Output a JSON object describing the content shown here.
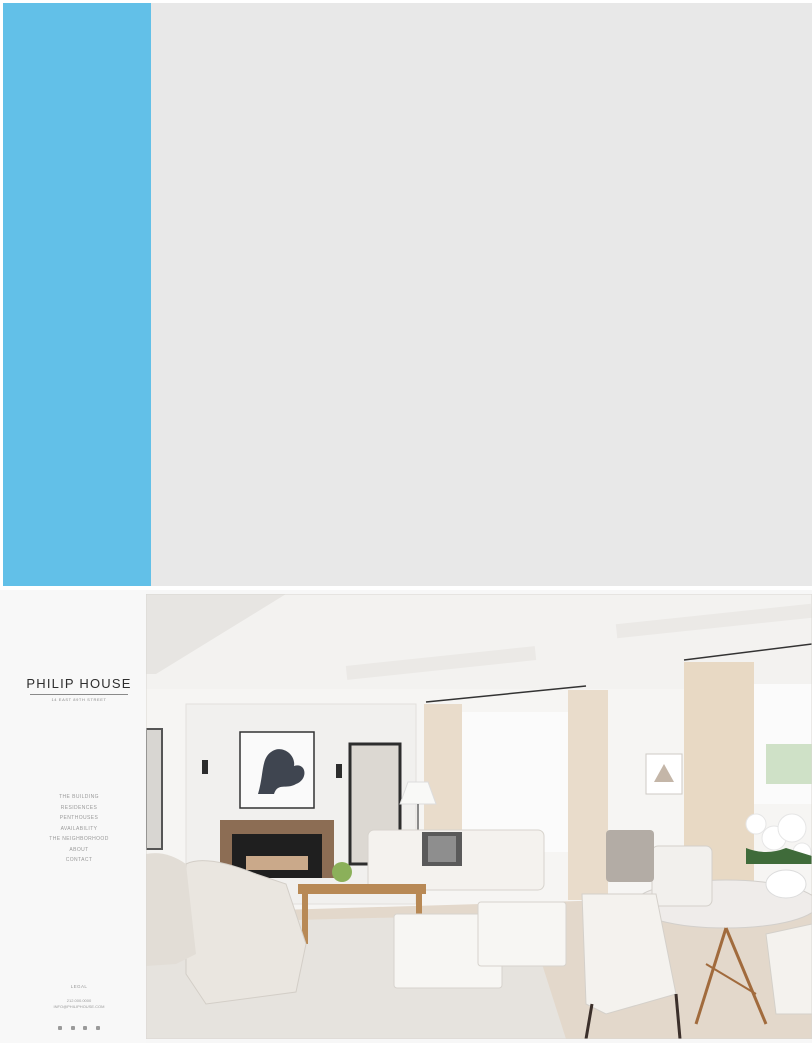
{
  "site": {
    "logo": "PHILIP HOUSE",
    "address": "14 EAST 89TH STREET",
    "nav": [
      "THE BUILDING",
      "RESIDENCES",
      "PENTHOUSES",
      "AVAILABILITY",
      "THE NEIGHBORHOOD",
      "ABOUT",
      "CONTACT"
    ],
    "legal": "LEGAL",
    "phone": "212.000.0000",
    "email": "INFO@PHILIPHOUSE.COM",
    "social_icons": [
      "facebook-icon",
      "twitter-icon",
      "pinterest-icon",
      "instagram-icon"
    ]
  },
  "colors": {
    "accent_blue": "#62c0e8",
    "placeholder_grey": "#e8e8e8"
  }
}
